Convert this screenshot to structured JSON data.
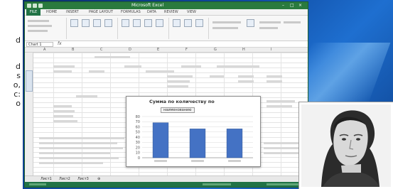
{
  "page_edge_text": [
    "d",
    "d",
    "s",
    "o,",
    "c:",
    "o"
  ],
  "excel": {
    "file_tab": "FILE",
    "window_title": "Microsoft Excel",
    "ribbon_tabs": [
      "HOME",
      "INSERT",
      "PAGE LAYOUT",
      "FORMULAS",
      "DATA",
      "REVIEW",
      "VIEW"
    ],
    "name_box": "Chart 1",
    "fx_label": "fx",
    "chart": {
      "title": "Сумма по количеству по",
      "subtitle": "наименованию"
    },
    "sheet_tabs": [
      "Лист1",
      "Лист2",
      "Лист3"
    ]
  },
  "chart_data": {
    "type": "bar",
    "title": "Сумма по количеству по",
    "subtitle": "наименованию",
    "categories": [
      "",
      "",
      ""
    ],
    "values": [
      68,
      56,
      56
    ],
    "ylim": [
      0,
      80
    ],
    "yticks": [
      0,
      10,
      20,
      30,
      40,
      50,
      60,
      70,
      80
    ],
    "bar_color": "#4472c4",
    "grid": true
  },
  "colors": {
    "excel_green": "#217346",
    "desktop_blue": "#0f4aa0"
  }
}
